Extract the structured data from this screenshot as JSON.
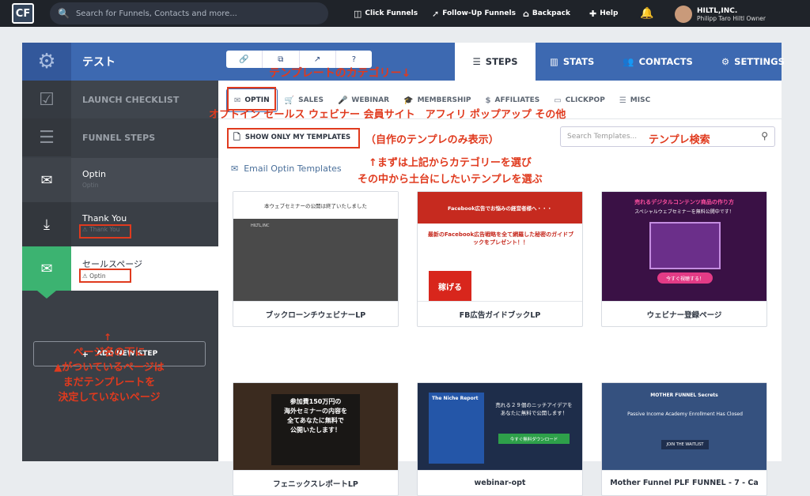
{
  "topbar": {
    "logo_text": "CF",
    "search_placeholder": "Search for Funnels, Contacts and more...",
    "nav": [
      {
        "label": "Click Funnels",
        "icon": "clickfunnels-icon"
      },
      {
        "label": "Follow-Up Funnels",
        "icon": "rocket-icon"
      },
      {
        "label": "Backpack",
        "icon": "backpack-icon"
      },
      {
        "label": "Help",
        "icon": "help-icon"
      }
    ],
    "bell_icon": "🔔",
    "user": {
      "company": "HILTL,INC.",
      "name_role": "Philipp Taro Hiltl   Owner"
    }
  },
  "funnel": {
    "title": "テスト",
    "tabs": [
      {
        "label": "STEPS",
        "icon": "☰",
        "active": true
      },
      {
        "label": "STATS",
        "icon": "▥"
      },
      {
        "label": "CONTACTS",
        "icon": "👥"
      },
      {
        "label": "SETTINGS",
        "icon": "⚙"
      }
    ],
    "mini_icons": [
      "🔗",
      "⧉",
      "↗",
      "?"
    ]
  },
  "sidebar": {
    "launch_checklist": "LAUNCH CHECKLIST",
    "funnel_steps": "FUNNEL STEPS",
    "steps": [
      {
        "name": "Optin",
        "sub": "Optin"
      },
      {
        "name": "Thank You",
        "sub": "Thank You"
      },
      {
        "name": "セールスページ",
        "sub": "Optin"
      }
    ],
    "add_step": "ADD NEW STEP",
    "warning_glyph": "⚠"
  },
  "content": {
    "categories": [
      {
        "label": "OPTIN",
        "icon": "✉",
        "active": true
      },
      {
        "label": "SALES",
        "icon": "🛒"
      },
      {
        "label": "WEBINAR",
        "icon": "🎤"
      },
      {
        "label": "MEMBERSHIP",
        "icon": "🎓"
      },
      {
        "label": "AFFILIATES",
        "icon": "$"
      },
      {
        "label": "CLICKPOP",
        "icon": "▭"
      },
      {
        "label": "MISC",
        "icon": "☰"
      }
    ],
    "show_only_mine": "SHOW ONLY MY TEMPLATES",
    "search_placeholder": "Search Templates...",
    "section_title": "Email Optin Templates",
    "templates": [
      {
        "caption": "ブックローンチウェビナーLP",
        "lines": [
          "本ウェブセミナーの公開は終了いたしました",
          "HILTL,INC"
        ]
      },
      {
        "caption": "FB広告ガイドブックLP",
        "lines": [
          "Facebook広告でお悩みの経営者様へ・・・",
          "最新のFacebook広告戦略を全て網羅した秘密のガイドブックをプレゼント！！",
          "稼げる"
        ]
      },
      {
        "caption": "ウェビナー登録ページ",
        "lines": [
          "売れるデジタルコンテンツ商品の作り方",
          "スペシャルウェブセミナーを無料公開中です！",
          "今すぐ視聴する！"
        ]
      },
      {
        "caption": "フェニックスレポートLP",
        "lines": [
          "参加費150万円の",
          "海外セミナーの内容を",
          "全てあなたに無料で",
          "公開いたします！"
        ]
      },
      {
        "caption": "webinar-opt",
        "lines": [
          "The Niche Report",
          "売れる２９個のニッチアイデアを",
          "あなたに無料で公開します！",
          "今すぐ無料ダウンロード"
        ]
      },
      {
        "caption": "Mother Funnel PLF FUNNEL - 7 - Ca",
        "lines": [
          "MOTHER FUNNEL Secrets",
          "Passive Income Academy Enrollment Has Closed",
          "JOIN THE WAITLIST"
        ]
      }
    ]
  },
  "annotations": {
    "category_title": "テンプレートのカテゴリー↓",
    "category_names": "オプトイン セールス ウェビナー 会員サイト　アフィリ ポップアップ その他",
    "own_only": "（自作のテンプレのみ表示）",
    "template_search": "テンプレ検索",
    "choose_1": "↑まずは上記からカテゴリーを選び",
    "choose_2": "その中から土台にしたいテンプレを選ぶ",
    "arrow_up": "↑",
    "note_1": "ページ名の下に",
    "note_2": "▲がついているページは",
    "note_3": "まだテンプレートを",
    "note_4": "決定していないページ"
  }
}
